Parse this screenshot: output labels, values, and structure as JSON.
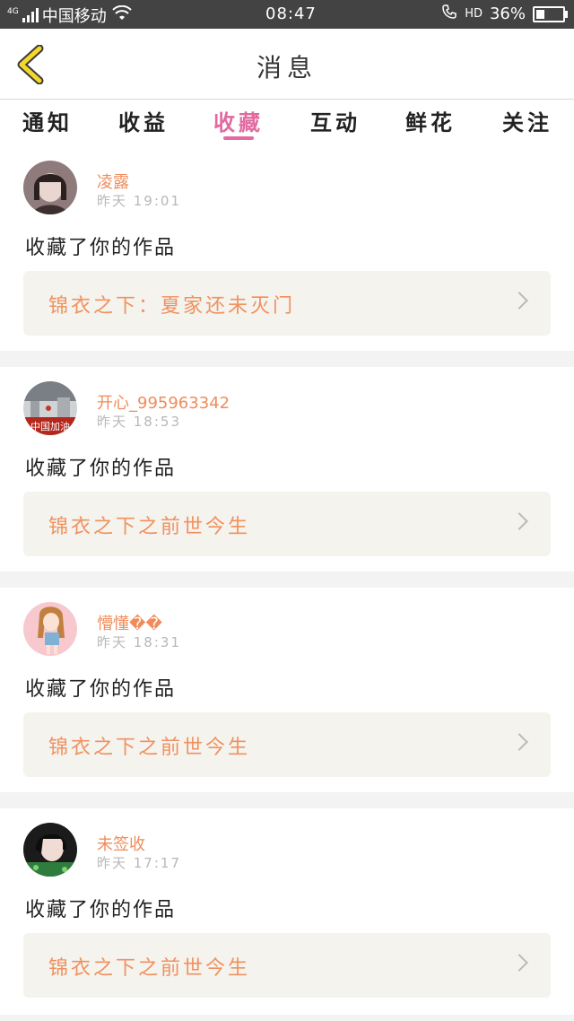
{
  "status_bar": {
    "network": "4G",
    "carrier": "中国移动",
    "time": "08:47",
    "hd": "HD",
    "battery_pct": "36%",
    "battery_level": 0.36
  },
  "header": {
    "title": "消息"
  },
  "tabs": [
    {
      "label": "通知"
    },
    {
      "label": "收益"
    },
    {
      "label": "收藏"
    },
    {
      "label": "互动"
    },
    {
      "label": "鲜花"
    },
    {
      "label": "关注"
    }
  ],
  "active_tab": "收藏",
  "messages": [
    {
      "user": "凌露",
      "time": "昨天  19:01",
      "action": "收藏了你的作品",
      "work": "锦衣之下：夏家还未灭门"
    },
    {
      "user": "开心_995963342",
      "time": "昨天  18:53",
      "action": "收藏了你的作品",
      "work": "锦衣之下之前世今生"
    },
    {
      "user": "懵懂��",
      "time": "昨天  18:31",
      "action": "收藏了你的作品",
      "work": "锦衣之下之前世今生"
    },
    {
      "user": "未签收",
      "time": "昨天  17:17",
      "action": "收藏了你的作品",
      "work": "锦衣之下之前世今生"
    }
  ],
  "avatar_2_text": "中国加油",
  "colors": {
    "accent_pink": "#e26aa0",
    "username_orange": "#f08c5a",
    "work_bg": "#f4f3ee",
    "statusbar_bg": "#434343",
    "back_arrow": "#f3d72a"
  }
}
